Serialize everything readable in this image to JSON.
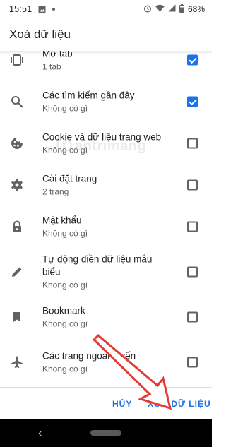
{
  "status_bar": {
    "time": "15:51",
    "battery_text": "68%"
  },
  "app_bar": {
    "title": "Xoá dữ liệu"
  },
  "items": [
    {
      "label": "Mở tab",
      "sub": "1 tab",
      "icon": "tabs-icon",
      "checked": true
    },
    {
      "label": "Các tìm kiếm gần đây",
      "sub": "Không có gì",
      "icon": "search-icon",
      "checked": true
    },
    {
      "label": "Cookie và dữ liệu trang web",
      "sub": "Không có gì",
      "icon": "cookie-icon",
      "checked": false
    },
    {
      "label": "Cài đặt trang",
      "sub": "2 trang",
      "icon": "gear-icon",
      "checked": false
    },
    {
      "label": "Mật khẩu",
      "sub": "Không có gì",
      "icon": "lock-icon",
      "checked": false
    },
    {
      "label": "Tự động điền dữ liệu mẫu biểu",
      "sub": "Không có gì",
      "icon": "pencil-icon",
      "checked": false
    },
    {
      "label": "Bookmark",
      "sub": "Không có gì",
      "icon": "bookmark-icon",
      "checked": false
    },
    {
      "label": "Các trang ngoại tuyến",
      "sub": "Không có gì",
      "icon": "airplane-icon",
      "checked": false
    }
  ],
  "footer": {
    "cancel_label": "HỦY",
    "clear_label": "XOÁ DỮ LIỆU"
  },
  "watermark": {
    "text": "antrimang"
  },
  "colors": {
    "accent": "#1a73e8",
    "arrow": "#e53935"
  }
}
